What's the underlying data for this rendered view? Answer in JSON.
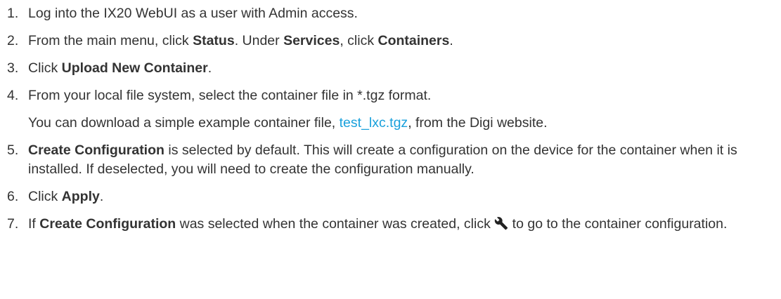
{
  "steps": [
    {
      "num": "1.",
      "text": "Log into the IX20 WebUI as a user with Admin access."
    },
    {
      "num": "2.",
      "a": "From the main menu, click ",
      "b1": "Status",
      "c": ". Under ",
      "b2": "Services",
      "d": ", click ",
      "b3": "Containers",
      "e": "."
    },
    {
      "num": "3.",
      "a": "Click ",
      "b1": "Upload New Container",
      "c": "."
    },
    {
      "num": "4.",
      "text": "From your local file system, select the container file in *.tgz format.",
      "note_a": "You can download a simple example container file, ",
      "note_link": "test_lxc.tgz",
      "note_b": ", from the Digi website."
    },
    {
      "num": "5.",
      "b1": "Create Configuration",
      "a": " is selected by default. This will create a configuration on the device for the container when it is installed. If deselected, you will need to create the configuration manually."
    },
    {
      "num": "6.",
      "a": "Click ",
      "b1": "Apply",
      "c": "."
    },
    {
      "num": "7.",
      "a": "If ",
      "b1": "Create Configuration",
      "c": " was selected when the container was created, click ",
      "icon": "wrench-icon",
      "d": " to go to the container configuration."
    }
  ],
  "colors": {
    "text": "#333333",
    "link": "#1aa1dc"
  }
}
